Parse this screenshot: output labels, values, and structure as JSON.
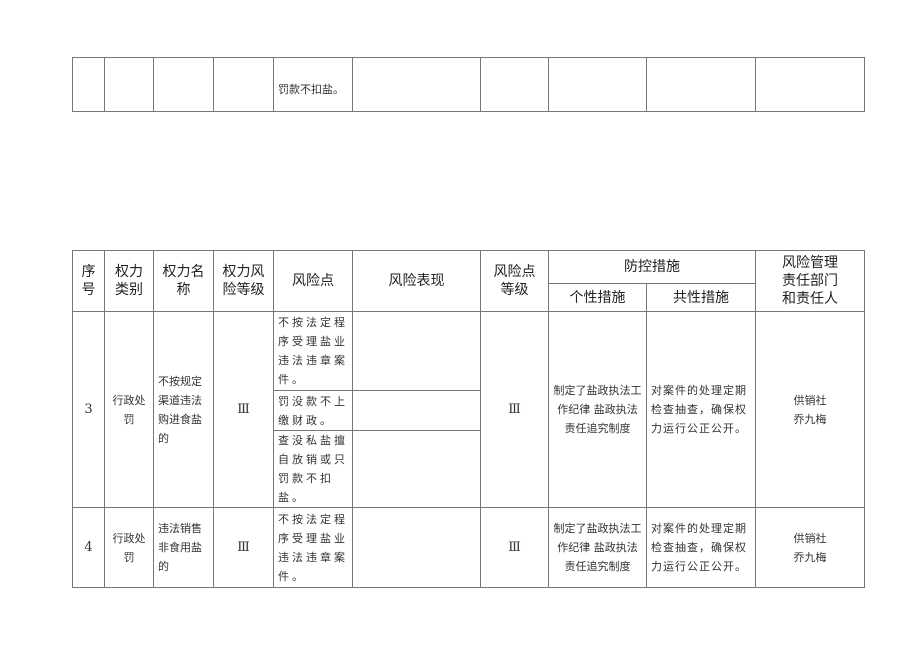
{
  "top_table": {
    "risk_point": "罚款不扣盐。"
  },
  "header": {
    "seq": "序\n号",
    "category": "权力\n类别",
    "name": "权力名\n称",
    "power_level": "权力风\n险等级",
    "risk_point": "风险点",
    "risk_manifestation": "风险表现",
    "risk_point_level": "风险点\n等级",
    "measures": "防控措施",
    "individual": "个性措施",
    "common": "共性措施",
    "responsible": "风险管理\n责任部门\n和责任人"
  },
  "rows": [
    {
      "seq": "3",
      "category": "行政处\n罚",
      "name": "不按规定渠道违法购进食盐的",
      "power_level": "Ⅲ",
      "risk_points": [
        "不按法定程序受理盐业违法违章案件。",
        "罚没款不上缴财政。",
        "查没私盐擅自放销或只罚款不扣盐。"
      ],
      "risk_point_level": "Ⅲ",
      "individual": "制定了盐政执法工作纪律 盐政执法责任追究制度",
      "common": "对案件的处理定期检查抽查，确保权力运行公正公开。",
      "responsible": "供销社\n乔九梅"
    },
    {
      "seq": "4",
      "category": "行政处\n罚",
      "name": "违法销售非食用盐的",
      "power_level": "Ⅲ",
      "risk_points": [
        "不按法定程序受理盐业违法违章案件。"
      ],
      "risk_point_level": "Ⅲ",
      "individual": "制定了盐政执法工作纪律 盐政执法责任追究制度",
      "common": "对案件的处理定期检查抽查，确保权力运行公正公开。",
      "responsible": "供销社\n乔九梅"
    }
  ]
}
